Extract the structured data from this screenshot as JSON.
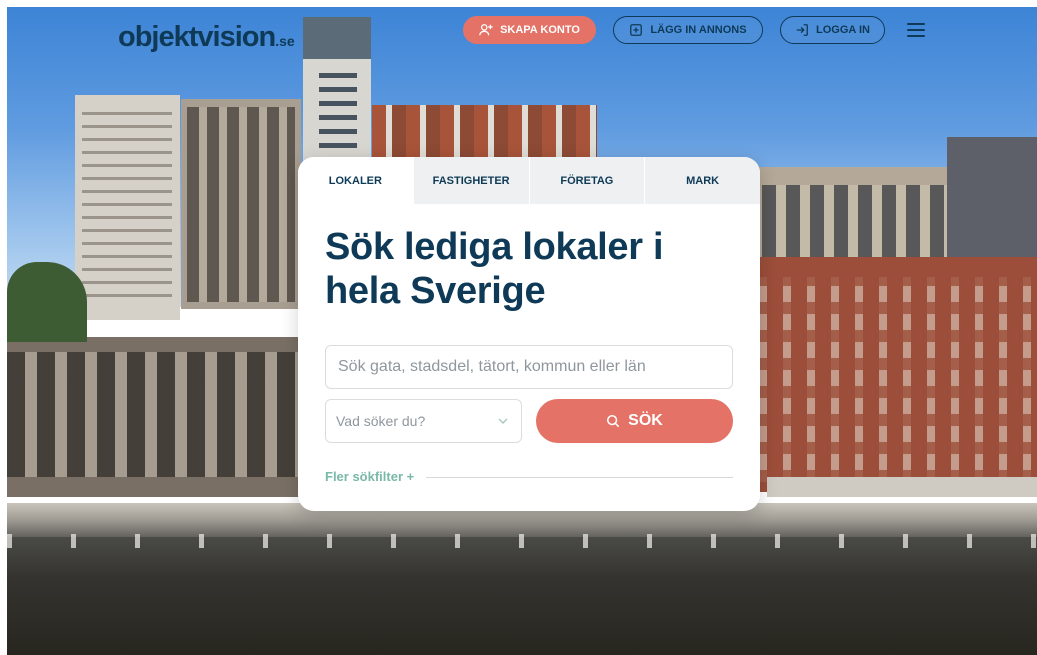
{
  "header": {
    "logo_text": "objektvision",
    "logo_suffix": ".se",
    "create_account": "SKAPA KONTO",
    "place_ad": "LÄGG IN ANNONS",
    "login": "LOGGA IN"
  },
  "tabs": [
    {
      "label": "LOKALER",
      "active": true
    },
    {
      "label": "FASTIGHETER",
      "active": false
    },
    {
      "label": "FÖRETAG",
      "active": false
    },
    {
      "label": "MARK",
      "active": false
    }
  ],
  "search": {
    "heading": "Sök lediga lokaler i hela Sverige",
    "placeholder": "Sök gata, stadsdel, tätort, kommun eller län",
    "type_select": "Vad söker du?",
    "button_label": "SÖK",
    "more_filters": "Fler sökfilter +"
  },
  "icons": {
    "create_account": "add-user-icon",
    "place_ad": "plus-square-icon",
    "login": "login-arrow-icon",
    "menu": "hamburger-menu-icon",
    "select": "chevron-down-icon",
    "search": "search-icon"
  },
  "colors": {
    "brand": "#0e3a57",
    "accent": "#e47266",
    "link": "#7ab8a8"
  }
}
